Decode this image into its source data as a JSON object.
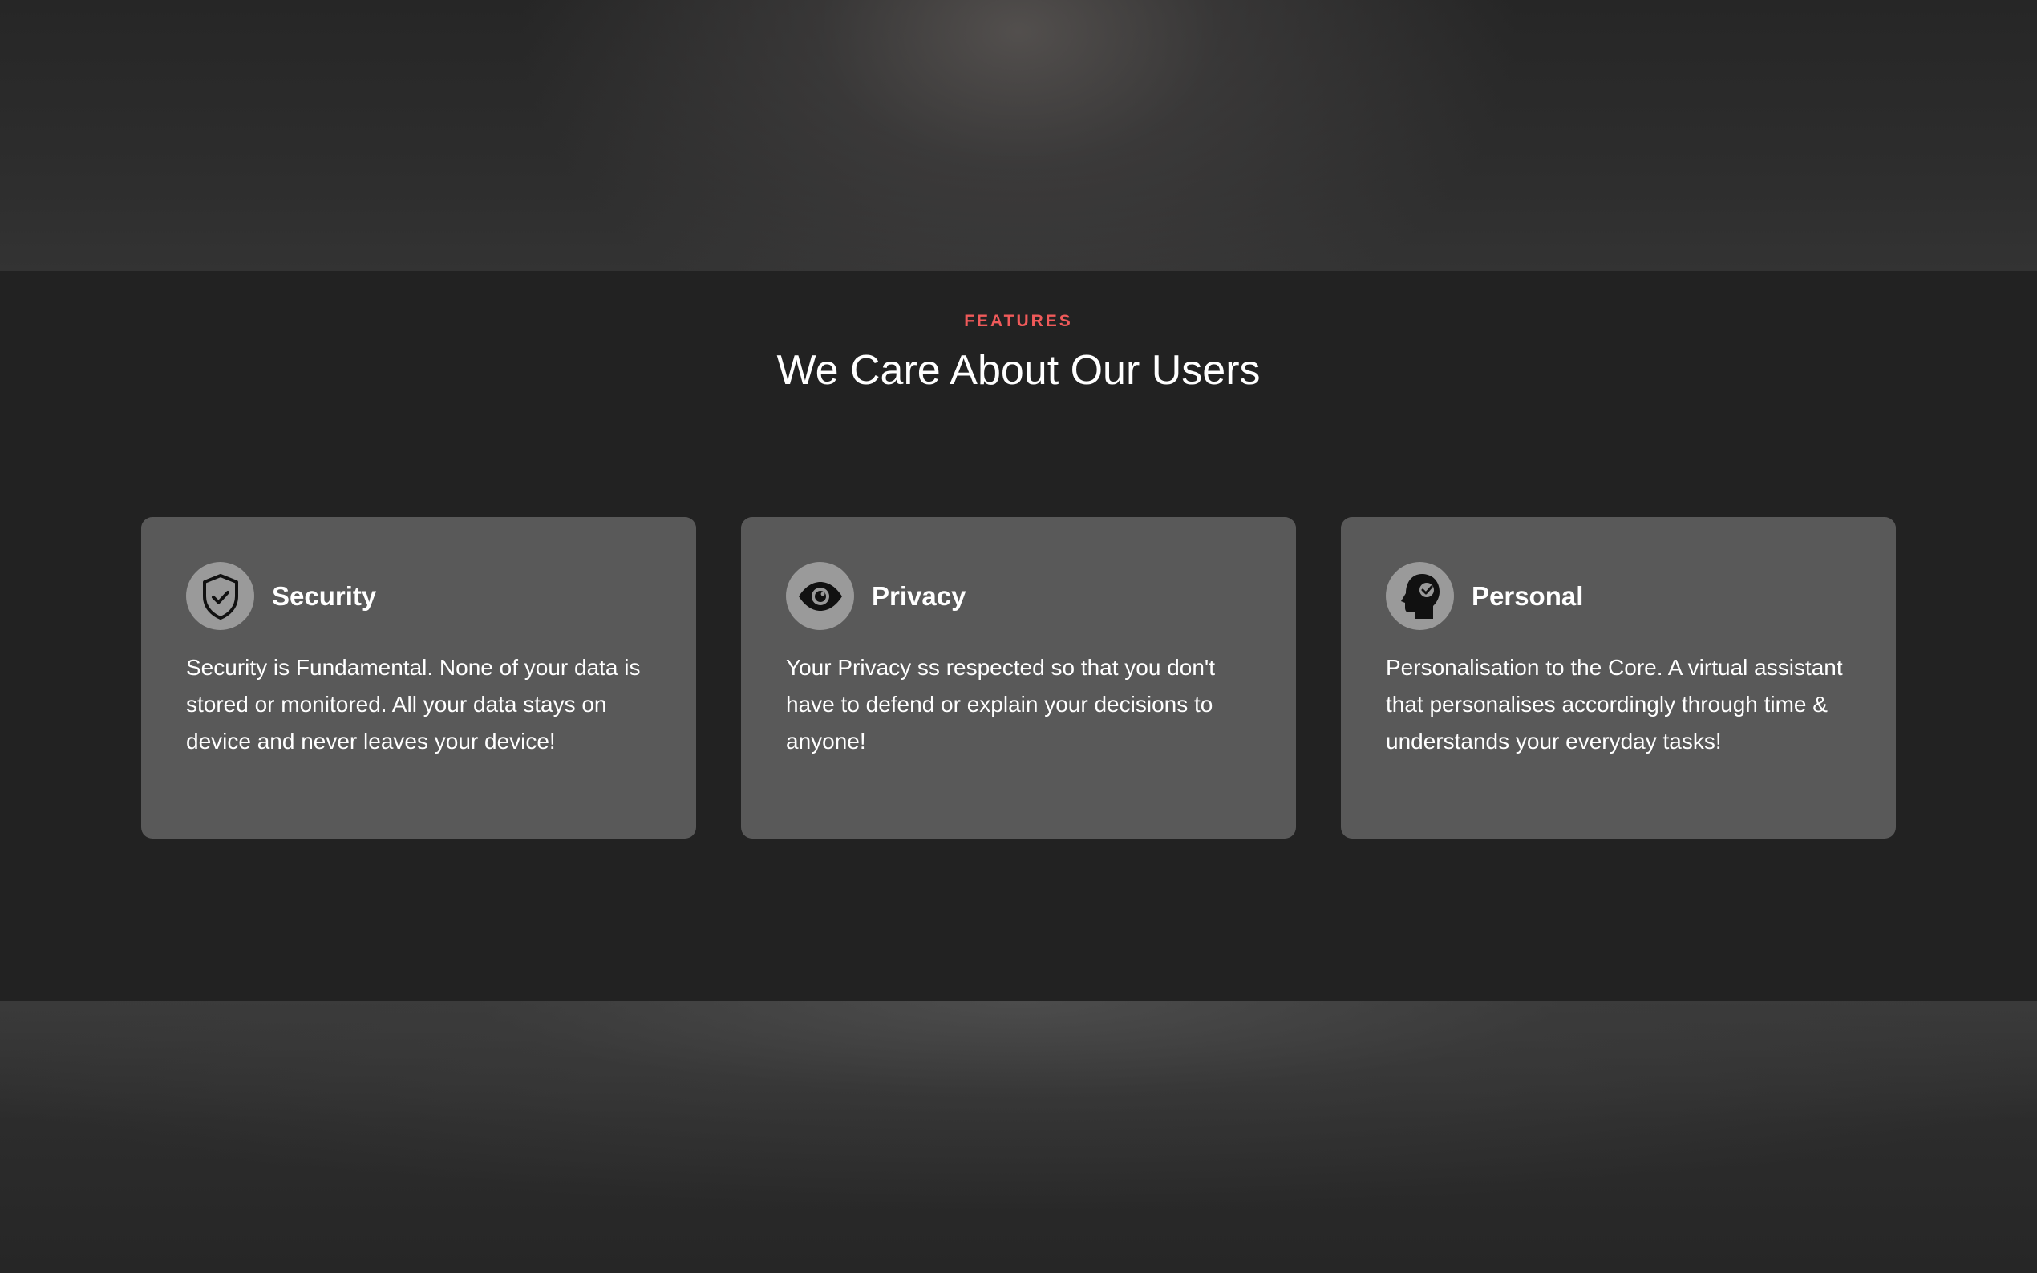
{
  "features": {
    "eyebrow": "FEATURES",
    "heading": "We Care About Our Users",
    "accent_color": "#f05a5a",
    "cards": [
      {
        "icon": "shield-check-icon",
        "title": "Security",
        "text": "Security is Fundamental. None of your data is stored or monitored. All your data stays on device and never leaves your device!"
      },
      {
        "icon": "eye-icon",
        "title": "Privacy",
        "text": "Your Privacy ss respected so that you don't have to defend or explain your decisions to anyone!"
      },
      {
        "icon": "head-profile-icon",
        "title": "Personal",
        "text": "Personalisation to the Core. A virtual assistant that personalises accordingly through time & understands your everyday tasks!"
      }
    ]
  }
}
